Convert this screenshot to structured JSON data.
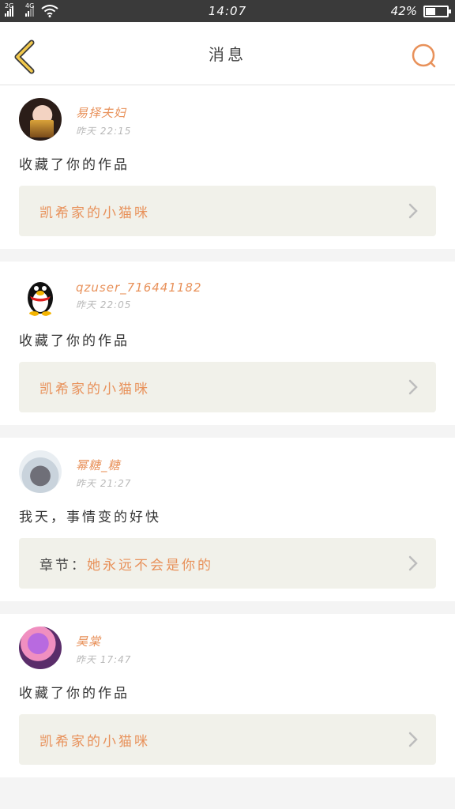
{
  "status_bar": {
    "sim1_tag": "2G",
    "sim2_tag": "4G",
    "time": "14:07",
    "battery_text": "42%",
    "battery_level": 0.42
  },
  "header": {
    "title": "消息",
    "back_icon": "chevron-left-icon",
    "search_icon": "search-icon",
    "accent_color": "#e8915a",
    "back_color": "#f2c94c"
  },
  "messages": [
    {
      "username": "易择夫妇",
      "time": "昨天 22:15",
      "action": "收藏了你的作品",
      "link_prefix": "",
      "link_text": "凯希家的小猫咪"
    },
    {
      "username": "qzuser_716441182",
      "time": "昨天 22:05",
      "action": "收藏了你的作品",
      "link_prefix": "",
      "link_text": "凯希家的小猫咪"
    },
    {
      "username": "幂糖_糖",
      "time": "昨天 21:27",
      "action": "我天，事情变的好快",
      "link_prefix": "章节：",
      "link_text": "她永远不会是你的"
    },
    {
      "username": "昊棠",
      "time": "昨天 17:47",
      "action": "收藏了你的作品",
      "link_prefix": "",
      "link_text": "凯希家的小猫咪"
    }
  ]
}
